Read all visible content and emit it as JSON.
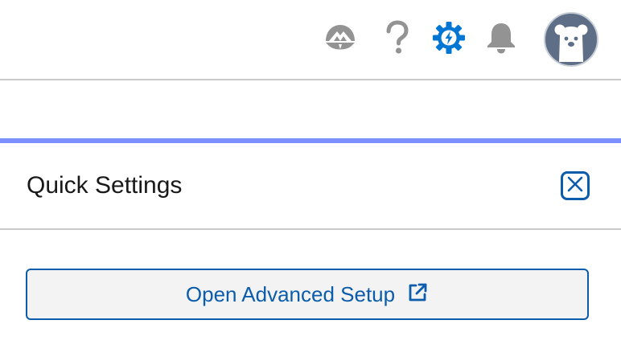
{
  "header": {
    "icons": {
      "trailhead": "trailhead-icon",
      "help": "help-icon",
      "setup": "setup-gear-icon",
      "notifications": "bell-icon",
      "avatar": "bear-avatar"
    }
  },
  "quick_settings": {
    "title": "Quick Settings",
    "close_icon": "close-icon",
    "advanced_button_label": "Open Advanced Setup",
    "advanced_button_icon": "external-link-icon"
  },
  "colors": {
    "brand_blue": "#0b5cab",
    "setup_icon_blue": "#0176d3",
    "accent_bar": "#7c8ffc",
    "icon_gray": "#939393",
    "avatar_bg": "#5f6e87",
    "button_bg": "#f3f3f3"
  }
}
